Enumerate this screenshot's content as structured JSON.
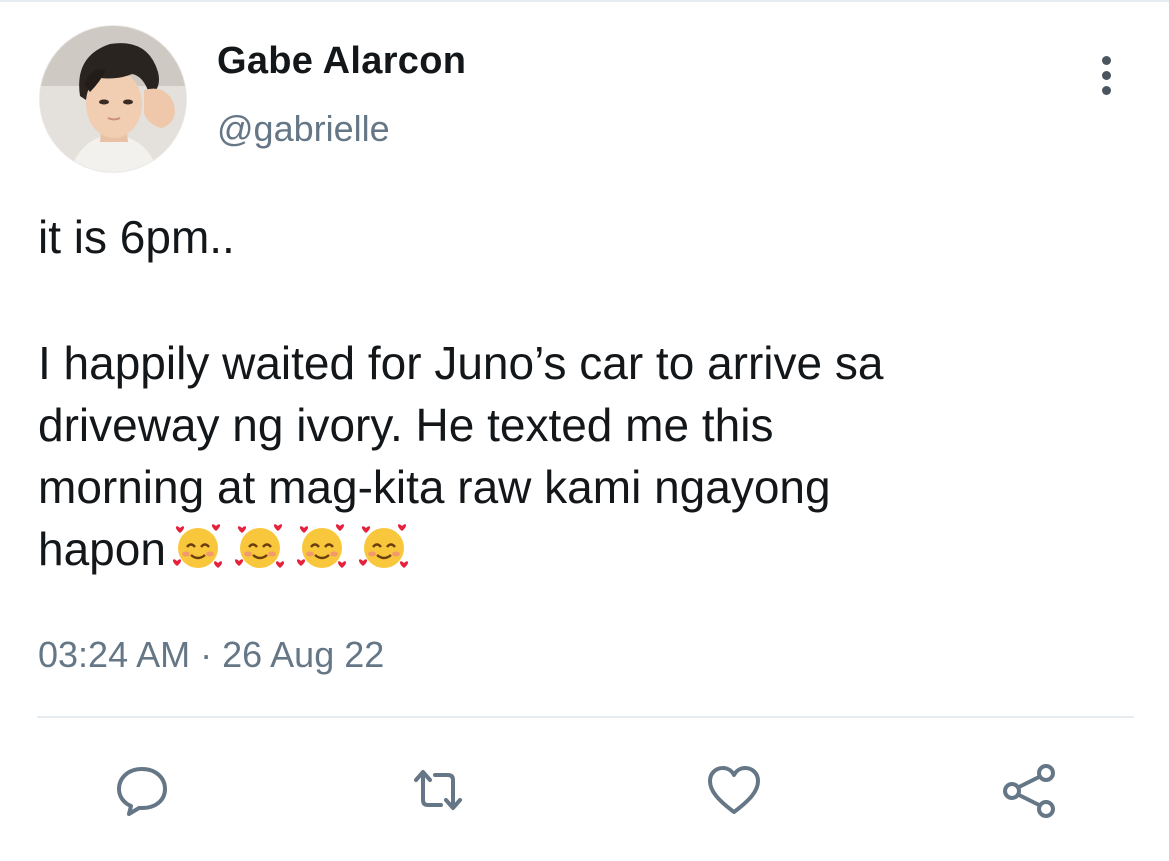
{
  "tweet": {
    "author": {
      "display_name": "Gabe Alarcon",
      "handle": "@gabrielle",
      "avatar_icon": "avatar"
    },
    "text": {
      "line1": "it is 6pm..",
      "paragraph2": [
        "I happily waited for Juno’s car to arrive sa",
        "driveway ng ivory. He texted me this",
        "morning at mag-kita raw kami ngayong",
        "hapon"
      ],
      "emojis": [
        "smiling-face-with-hearts-icon",
        "smiling-face-with-hearts-icon",
        "smiling-face-with-hearts-icon",
        "smiling-face-with-hearts-icon"
      ]
    },
    "timestamp": "03:24 AM · 26 Aug 22"
  },
  "actions": [
    {
      "name": "reply-icon"
    },
    {
      "name": "retweet-icon"
    },
    {
      "name": "like-icon"
    },
    {
      "name": "share-icon"
    }
  ],
  "colors": {
    "text_primary": "#14171a",
    "text_secondary": "#657786",
    "icon": "#657786",
    "divider": "#e6ecf0"
  }
}
